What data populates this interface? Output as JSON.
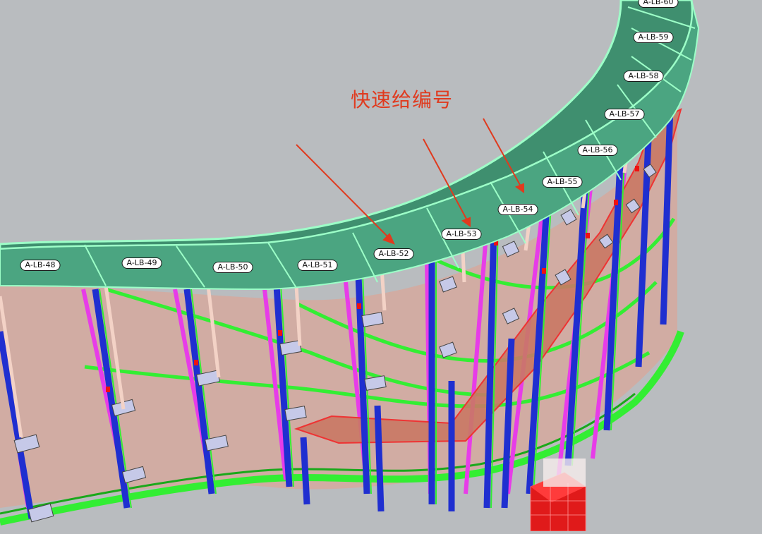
{
  "annotation": {
    "text": "快速给编号",
    "color": "#e03a1e"
  },
  "panel_labels": [
    "A-LB-48",
    "A-LB-49",
    "A-LB-50",
    "A-LB-51",
    "A-LB-52",
    "A-LB-53",
    "A-LB-54",
    "A-LB-55",
    "A-LB-56",
    "A-LB-57",
    "A-LB-58",
    "A-LB-59",
    "A-LB-60"
  ],
  "colors": {
    "background": "#b9bcbf",
    "top_panel": "#3f8f6f",
    "panel_edge": "#9dffc8",
    "wall_membrane": "#d9a79a",
    "column": "#1f2fd0",
    "brace": "#e73ce8",
    "purlin": "#33ee33",
    "stair": "#c97864",
    "support_box": "#e01a1a"
  }
}
